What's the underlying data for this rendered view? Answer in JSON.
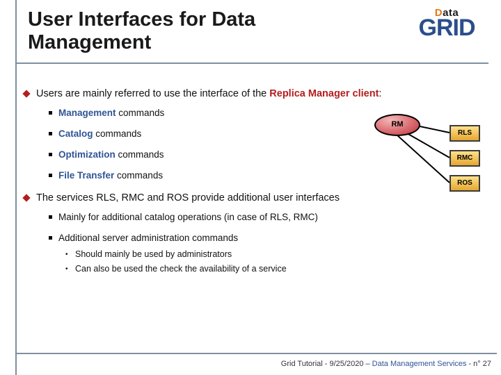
{
  "title": "User Interfaces for Data Management",
  "logo": {
    "data_word": "Data",
    "grid_word": "GRID"
  },
  "b1": {
    "pre": "Users are mainly referred to use the interface of the ",
    "em": "Replica Manager client",
    "post": ":",
    "items": [
      {
        "em": "Management",
        "rest": " commands"
      },
      {
        "em": "Catalog",
        "rest": " commands"
      },
      {
        "em": "Optimization",
        "rest": " commands"
      },
      {
        "em": "File Transfer",
        "rest": " commands"
      }
    ]
  },
  "b2": {
    "text": "The services RLS, RMC and ROS provide additional user interfaces",
    "items": [
      {
        "text": "Mainly for additional catalog operations (in case of RLS, RMC)"
      },
      {
        "text": "Additional server administration commands",
        "sub": [
          "Should mainly be used by administrators",
          "Can also be used the check the availability of a service"
        ]
      }
    ]
  },
  "diagram": {
    "rm": "RM",
    "rls": "RLS",
    "rmc": "RMC",
    "ros": "ROS"
  },
  "footer": {
    "left": "Grid Tutorial",
    "sep1": " - ",
    "date": "9/25/2020",
    "sep2": " – ",
    "svc": "Data Management Services",
    "page": " - n° 27"
  }
}
